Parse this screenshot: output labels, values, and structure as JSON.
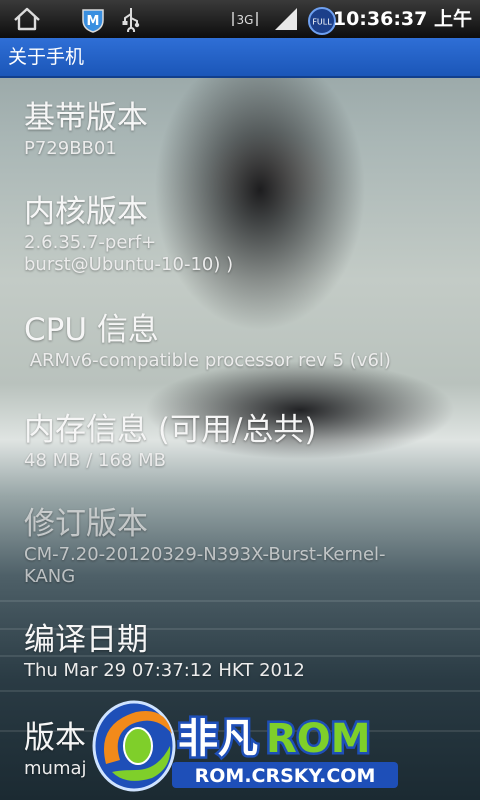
{
  "status_bar": {
    "time": "10:36:37 上午",
    "signal_type": "3G",
    "battery_label": "FULL",
    "icons": [
      "home-icon",
      "shield-app-icon",
      "usb-icon",
      "data-3g-icon",
      "signal-icon",
      "battery-icon"
    ]
  },
  "title_bar": {
    "title": "关于手机"
  },
  "items": [
    {
      "label": "基带版本",
      "value": "P729BB01"
    },
    {
      "label": "内核版本",
      "value_lines": [
        "2.6.35.7-perf+",
        "burst@Ubuntu-10-10) )"
      ]
    },
    {
      "label": "CPU 信息",
      "value": " ARMv6-compatible processor rev 5 (v6l)"
    },
    {
      "label": "内存信息 (可用/总共)",
      "value": "48 MB / 168 MB"
    },
    {
      "label": "修订版本",
      "value_lines": [
        "CM-7.20-20120329-N393X-Burst-Kernel-",
        "KANG"
      ]
    },
    {
      "label": "编译日期",
      "value": "Thu Mar 29 07:37:12 HKT 2012"
    },
    {
      "label": "版本",
      "value": "mumaj"
    }
  ],
  "watermark": {
    "brand_cn": "非凡",
    "brand_en": "ROM",
    "url": "ROM.CRSKY.COM"
  },
  "colors": {
    "title_bar": "#2366c8",
    "status_bar": "#1a1a1a",
    "logo_green": "#7fcf2a",
    "logo_blue": "#1e4fb8",
    "logo_orange": "#f28a1a"
  }
}
